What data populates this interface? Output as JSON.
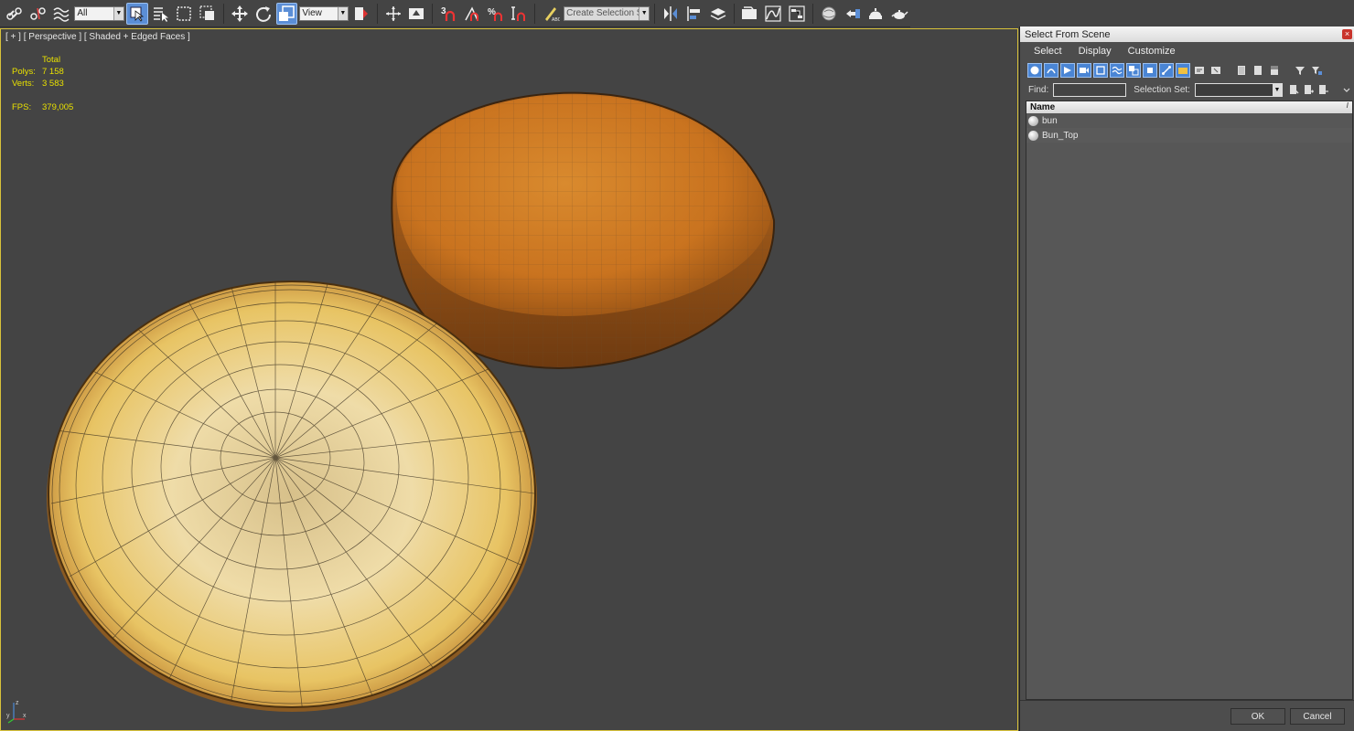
{
  "toolbar": {
    "filter_combo": "All",
    "ref_coord_combo": "View",
    "snap_label": "3",
    "angle_snap_label": "A",
    "percent_snap_label": "%",
    "named_selection_placeholder": "Create Selection Se",
    "icons": [
      "link-icon",
      "unlink-icon",
      "bind-spacewarp-icon",
      "select-object-icon",
      "select-by-name-icon",
      "rect-region-icon",
      "window-crossing-icon",
      "move-icon",
      "rotate-icon",
      "scale-icon",
      "mirror-snap-icon",
      "pivot-icon",
      "manipulate-icon",
      "snap-icon",
      "angle-snap-icon",
      "percent-snap-icon",
      "spinner-snap-icon",
      "edit-named-sel-icon",
      "mirror-icon",
      "align-icon",
      "layer-icon",
      "scene-explorer-icon",
      "curve-editor-icon",
      "schematic-icon",
      "material-editor-icon",
      "render-setup-icon",
      "render-frame-icon",
      "render-icon"
    ]
  },
  "viewport": {
    "label": "[ + ] [ Perspective ] [ Shaded + Edged Faces ]",
    "stats": {
      "total_label": "Total",
      "polys_label": "Polys:",
      "polys_value": "7 158",
      "verts_label": "Verts:",
      "verts_value": "3 583",
      "fps_label": "FPS:",
      "fps_value": "379,005"
    },
    "axis_labels": {
      "x": "x",
      "y": "y",
      "z": "z"
    },
    "colors": {
      "border": "#d8c23a",
      "background": "#444444",
      "bun_top": "#c9731f",
      "bun_bottom": "#e8d08a",
      "wire": "#2a2a2a"
    }
  },
  "dialog": {
    "title": "Select From Scene",
    "close": "×",
    "menu": [
      "Select",
      "Display",
      "Customize"
    ],
    "find_label": "Find:",
    "selection_set_label": "Selection Set:",
    "column_header": "Name",
    "sort_indicator": "/",
    "objects": [
      {
        "name": "bun"
      },
      {
        "name": "Bun_Top"
      }
    ],
    "ok_label": "OK",
    "cancel_label": "Cancel",
    "accent": "#4a85d4"
  }
}
